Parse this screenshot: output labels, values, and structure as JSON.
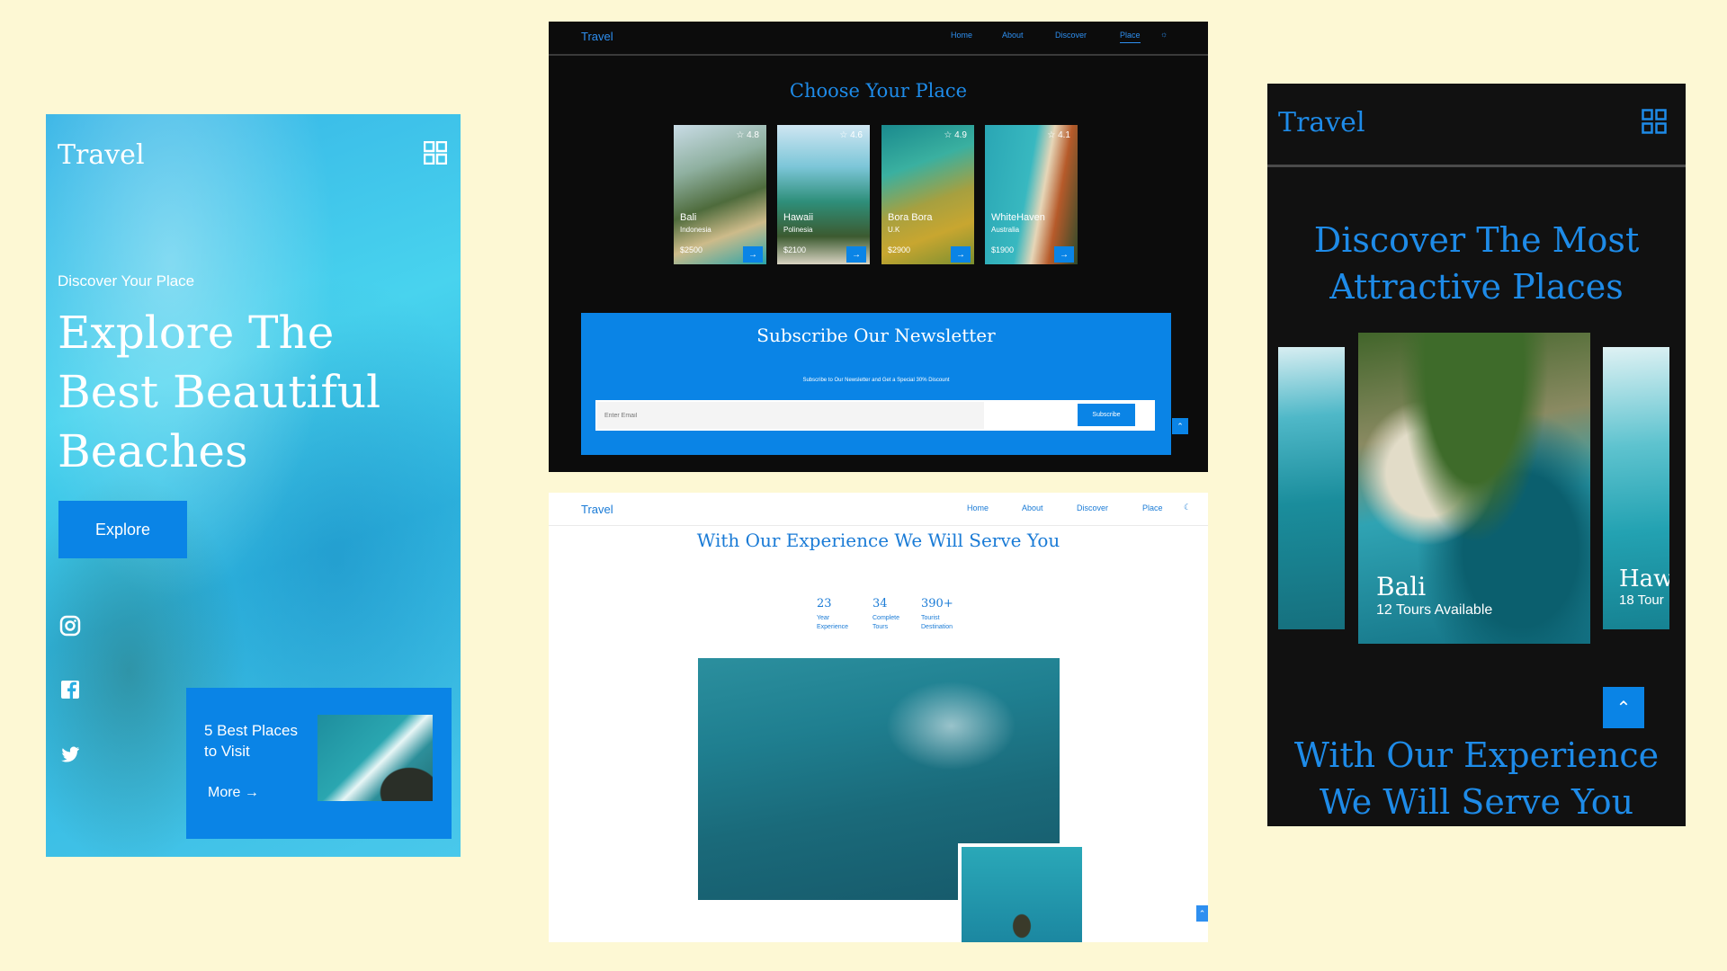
{
  "mobile_light": {
    "logo": "Travel",
    "kicker": "Discover Your Place",
    "hero_title": "Explore The Best Beautiful Beaches",
    "explore_button": "Explore",
    "card_title": "5 Best Places to Visit",
    "card_more": "More"
  },
  "desktop_dark": {
    "logo": "Travel",
    "nav": [
      "Home",
      "About",
      "Discover",
      "Place"
    ],
    "title": "Choose Your Place",
    "places": [
      {
        "name": "Bali",
        "country": "Indonesia",
        "price": "$2500",
        "rating": "4.8"
      },
      {
        "name": "Hawaii",
        "country": "Polinesia",
        "price": "$2100",
        "rating": "4.6"
      },
      {
        "name": "Bora Bora",
        "country": "U.K",
        "price": "$2900",
        "rating": "4.9"
      },
      {
        "name": "WhiteHaven",
        "country": "Australia",
        "price": "$1900",
        "rating": "4.1"
      }
    ],
    "newsletter": {
      "title": "Subscribe Our Newsletter",
      "subtitle": "Subscribe to Our Newsletter and Get a Special 30% Discount",
      "placeholder": "Enter Email",
      "button": "Subscribe"
    }
  },
  "desktop_light": {
    "logo": "Travel",
    "nav": [
      "Home",
      "About",
      "Discover",
      "Place"
    ],
    "title": "With Our Experience We Will Serve You",
    "stats": [
      {
        "number": "23",
        "label": "Year Experience"
      },
      {
        "number": "34",
        "label": "Complete Tours"
      },
      {
        "number": "390+",
        "label": "Tourist Destination"
      }
    ]
  },
  "mobile_dark": {
    "logo": "Travel",
    "title": "Discover The Most Attractive Places",
    "main_card": {
      "name": "Bali",
      "tours": "12 Tours Available"
    },
    "side_card": {
      "name": "Haw",
      "tours": "18 Tour"
    },
    "experience_title": "With Our Experience We Will Serve You"
  }
}
